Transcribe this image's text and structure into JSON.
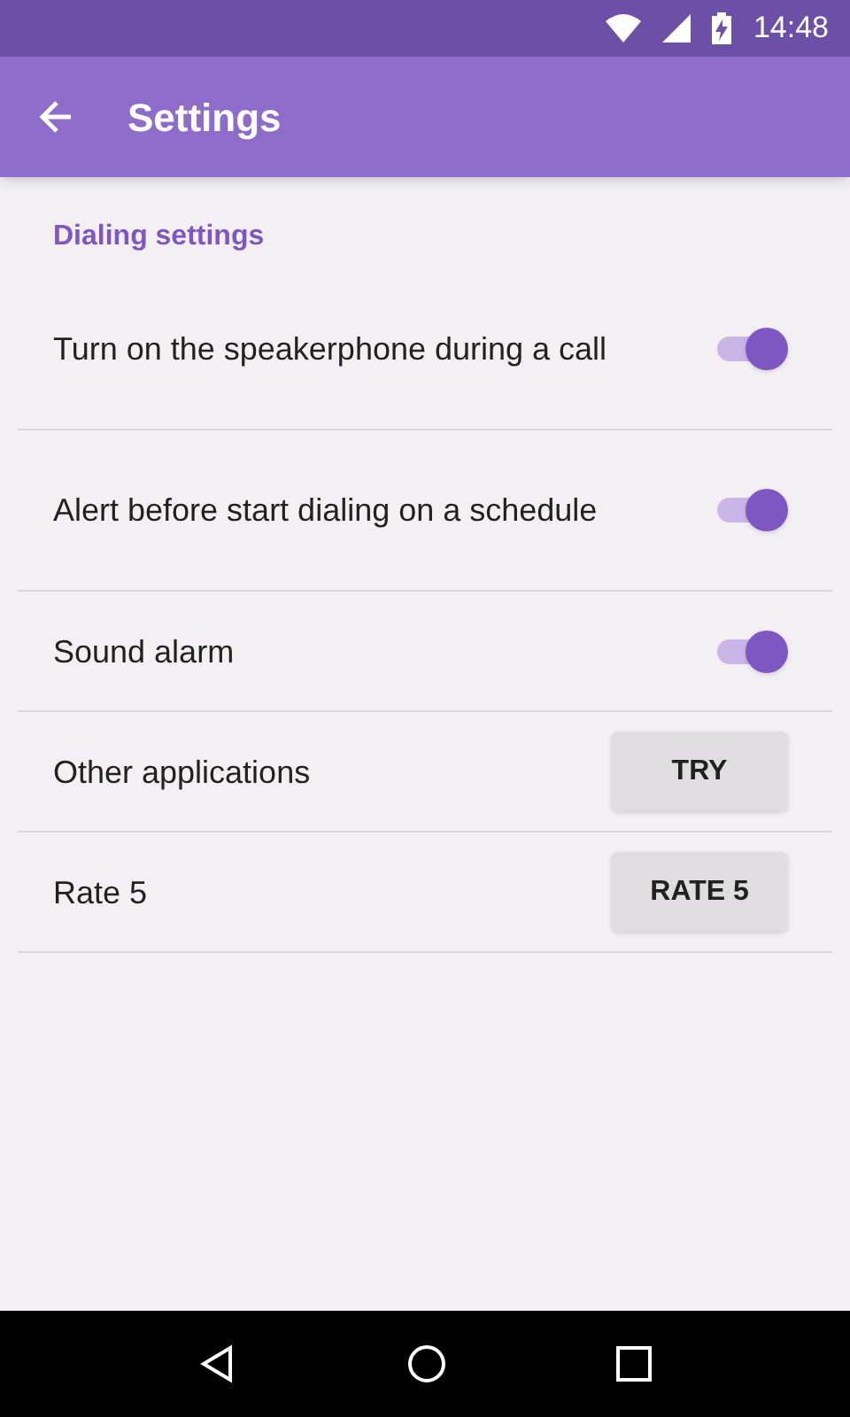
{
  "status_bar": {
    "time": "14:48"
  },
  "app_bar": {
    "title": "Settings"
  },
  "section_title": "Dialing settings",
  "items": [
    {
      "kind": "switch",
      "label": "Turn on the speakerphone during a call",
      "on": true
    },
    {
      "kind": "switch",
      "label": "Alert before start dialing on a schedule",
      "on": true
    },
    {
      "kind": "switch",
      "label": "Sound alarm",
      "on": true
    },
    {
      "kind": "button",
      "label": "Other applications",
      "button_label": "TRY"
    },
    {
      "kind": "button",
      "label": "Rate 5",
      "button_label": "RATE 5"
    }
  ]
}
